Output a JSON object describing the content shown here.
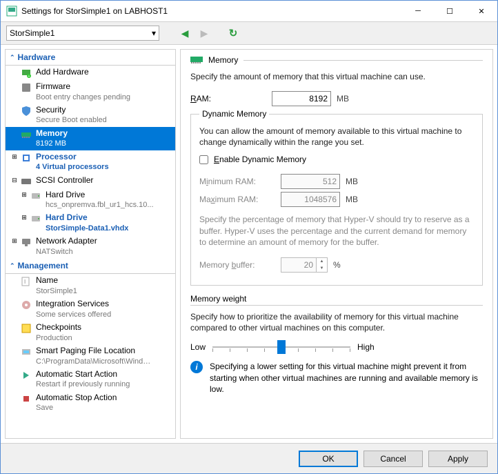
{
  "window": {
    "title": "Settings for StorSimple1 on LABHOST1"
  },
  "toolbar": {
    "vm_name": "StorSimple1"
  },
  "tree": {
    "hardware_header": "Hardware",
    "add_hardware": "Add Hardware",
    "firmware": "Firmware",
    "firmware_sub": "Boot entry changes pending",
    "security": "Security",
    "security_sub": "Secure Boot enabled",
    "memory": "Memory",
    "memory_sub": "8192 MB",
    "processor": "Processor",
    "processor_sub": "4 Virtual processors",
    "scsi": "SCSI Controller",
    "hdd1": "Hard Drive",
    "hdd1_sub": "hcs_onpremva.fbl_ur1_hcs.10...",
    "hdd2": "Hard Drive",
    "hdd2_sub": "StorSimple-Data1.vhdx",
    "net": "Network Adapter",
    "net_sub": "NATSwitch",
    "management_header": "Management",
    "name": "Name",
    "name_sub": "StorSimple1",
    "intsvc": "Integration Services",
    "intsvc_sub": "Some services offered",
    "chk": "Checkpoints",
    "chk_sub": "Production",
    "spage": "Smart Paging File Location",
    "spage_sub": "C:\\ProgramData\\Microsoft\\Windo...",
    "astart": "Automatic Start Action",
    "astart_sub": "Restart if previously running",
    "astop": "Automatic Stop Action",
    "astop_sub": "Save"
  },
  "panel": {
    "title": "Memory",
    "intro": "Specify the amount of memory that this virtual machine can use.",
    "ram_label": "RAM:",
    "ram_value": "8192",
    "ram_unit": "MB",
    "dyn_legend": "Dynamic Memory",
    "dyn_text": "You can allow the amount of memory available to this virtual machine to change dynamically within the range you set.",
    "dyn_enable": "Enable Dynamic Memory",
    "min_label": "Minimum RAM:",
    "min_value": "512",
    "min_unit": "MB",
    "max_label": "Maximum RAM:",
    "max_value": "1048576",
    "max_unit": "MB",
    "dyn_desc": "Specify the percentage of memory that Hyper-V should try to reserve as a buffer. Hyper-V uses the percentage and the current demand for memory to determine an amount of memory for the buffer.",
    "buf_label": "Memory buffer:",
    "buf_value": "20",
    "buf_unit": "%",
    "weight_title": "Memory weight",
    "weight_text": "Specify how to prioritize the availability of memory for this virtual machine compared to other virtual machines on this computer.",
    "weight_low": "Low",
    "weight_high": "High",
    "info_text": "Specifying a lower setting for this virtual machine might prevent it from starting when other virtual machines are running and available memory is low."
  },
  "footer": {
    "ok": "OK",
    "cancel": "Cancel",
    "apply": "Apply"
  }
}
